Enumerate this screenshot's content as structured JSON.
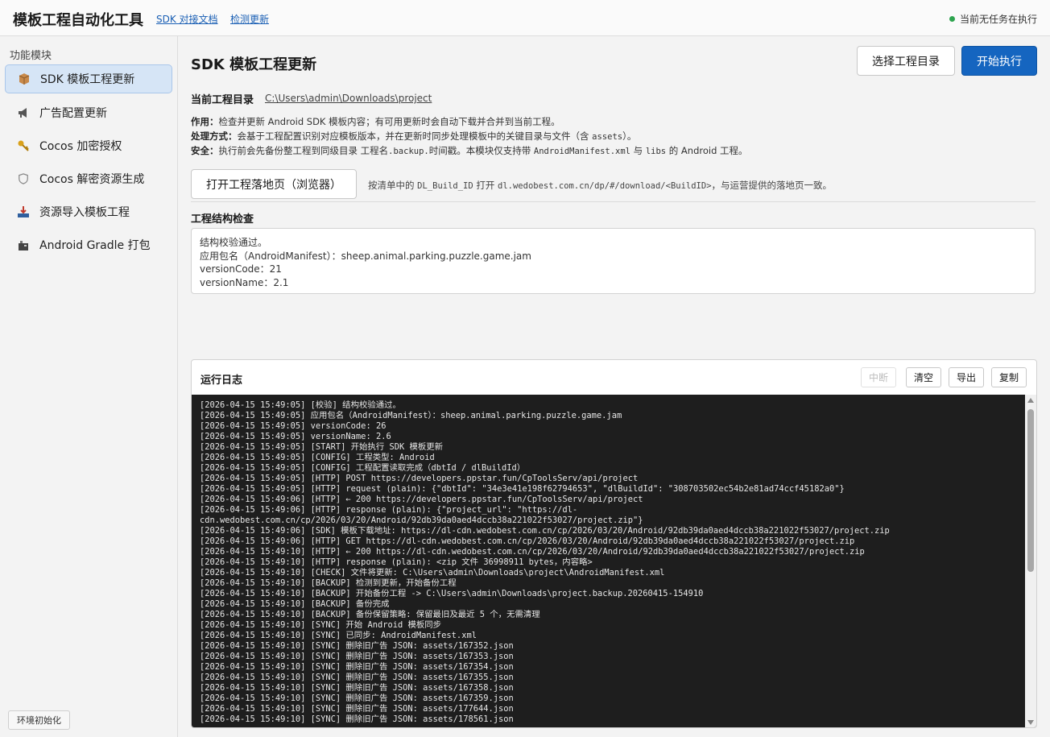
{
  "header": {
    "app_title": "模板工程自动化工具",
    "links": [
      "SDK 对接文档",
      "检测更新"
    ],
    "status": "当前无任务在执行"
  },
  "sidebar": {
    "title": "功能模块",
    "items": [
      {
        "label": "SDK 模板工程更新",
        "icon": "package-icon",
        "active": true
      },
      {
        "label": "广告配置更新",
        "icon": "megaphone-icon",
        "active": false
      },
      {
        "label": "Cocos 加密授权",
        "icon": "key-icon",
        "active": false
      },
      {
        "label": "Cocos 解密资源生成",
        "icon": "shield-icon",
        "active": false
      },
      {
        "label": "资源导入模板工程",
        "icon": "import-icon",
        "active": false
      },
      {
        "label": "Android Gradle 打包",
        "icon": "build-icon",
        "active": false
      }
    ],
    "env_button": "环境初始化"
  },
  "main": {
    "title": "SDK 模板工程更新",
    "select_dir_button": "选择工程目录",
    "start_button": "开始执行",
    "dir_label": "当前工程目录",
    "dir_value": "C:\\Users\\admin\\Downloads\\project",
    "desc": {
      "purpose_label": "作用：",
      "purpose_text": "检查并更新 Android SDK 模板内容；有可用更新时会自动下载并合并到当前工程。",
      "method_label": "处理方式：",
      "method_text_1": "会基于工程配置识别对应模板版本，并在更新时同步处理模板中的关键目录与文件（含 ",
      "method_code": "assets",
      "method_text_2": "）。",
      "safety_label": "安全：",
      "safety_text_1": "执行前会先备份整工程到同级目录 工程名",
      "safety_code_1": ".backup.",
      "safety_text_2": "时间戳。本模块仅支持带 ",
      "safety_code_2": "AndroidManifest.xml",
      "safety_text_3": " 与 ",
      "safety_code_3": "libs",
      "safety_text_4": " 的 Android 工程。"
    },
    "landing_button": "打开工程落地页（浏览器）",
    "hint": {
      "text_1": "按清单中的 ",
      "code_1": "DL_Build_ID",
      "text_2": " 打开 ",
      "code_2": "dl.wedobest.com.cn/dp/#/download/<BuildID>",
      "text_3": "，与运营提供的落地页一致。"
    },
    "check_title": "工程结构检查",
    "check_lines": [
      "结构校验通过。",
      "应用包名（AndroidManifest）：sheep.animal.parking.puzzle.game.jam",
      "versionCode：21",
      "versionName：2.1"
    ]
  },
  "log": {
    "title": "运行日志",
    "buttons": {
      "interrupt": "中断",
      "clear": "清空",
      "export": "导出",
      "copy": "复制"
    },
    "lines": [
      "[2026-04-15 15:49:05] [校验] 结构校验通过。",
      "[2026-04-15 15:49:05] 应用包名（AndroidManifest）：sheep.animal.parking.puzzle.game.jam",
      "[2026-04-15 15:49:05] versionCode: 26",
      "[2026-04-15 15:49:05] versionName: 2.6",
      "[2026-04-15 15:49:05] [START] 开始执行 SDK 模板更新",
      "[2026-04-15 15:49:05] [CONFIG] 工程类型: Android",
      "[2026-04-15 15:49:05] [CONFIG] 工程配置读取完成（dbtId / dlBuildId）",
      "[2026-04-15 15:49:05] [HTTP] POST https://developers.ppstar.fun/CpToolsServ/api/project",
      "[2026-04-15 15:49:05] [HTTP] request (plain): {\"dbtId\": \"34e3e41e198f62794653\", \"dlBuildId\": \"308703502ec54b2e81ad74ccf45182a0\"}",
      "[2026-04-15 15:49:06] [HTTP] ← 200 https://developers.ppstar.fun/CpToolsServ/api/project",
      "[2026-04-15 15:49:06] [HTTP] response (plain): {\"project_url\": \"https://dl-",
      "cdn.wedobest.com.cn/cp/2026/03/20/Android/92db39da0aed4dccb38a221022f53027/project.zip\"}",
      "[2026-04-15 15:49:06] [SDK] 模板下载地址: https://dl-cdn.wedobest.com.cn/cp/2026/03/20/Android/92db39da0aed4dccb38a221022f53027/project.zip",
      "[2026-04-15 15:49:06] [HTTP] GET https://dl-cdn.wedobest.com.cn/cp/2026/03/20/Android/92db39da0aed4dccb38a221022f53027/project.zip",
      "[2026-04-15 15:49:10] [HTTP] ← 200 https://dl-cdn.wedobest.com.cn/cp/2026/03/20/Android/92db39da0aed4dccb38a221022f53027/project.zip",
      "[2026-04-15 15:49:10] [HTTP] response (plain): <zip 文件 36998911 bytes，内容略>",
      "[2026-04-15 15:49:10] [CHECK] 文件将更新: C:\\Users\\admin\\Downloads\\project\\AndroidManifest.xml",
      "[2026-04-15 15:49:10] [BACKUP] 检测到更新，开始备份工程",
      "[2026-04-15 15:49:10] [BACKUP] 开始备份工程 -> C:\\Users\\admin\\Downloads\\project.backup.20260415-154910",
      "[2026-04-15 15:49:10] [BACKUP] 备份完成",
      "[2026-04-15 15:49:10] [BACKUP] 备份保留策略: 保留最旧及最近 5 个，无需清理",
      "[2026-04-15 15:49:10] [SYNC] 开始 Android 模板同步",
      "[2026-04-15 15:49:10] [SYNC] 已同步: AndroidManifest.xml",
      "[2026-04-15 15:49:10] [SYNC] 删除旧广告 JSON: assets/167352.json",
      "[2026-04-15 15:49:10] [SYNC] 删除旧广告 JSON: assets/167353.json",
      "[2026-04-15 15:49:10] [SYNC] 删除旧广告 JSON: assets/167354.json",
      "[2026-04-15 15:49:10] [SYNC] 删除旧广告 JSON: assets/167355.json",
      "[2026-04-15 15:49:10] [SYNC] 删除旧广告 JSON: assets/167358.json",
      "[2026-04-15 15:49:10] [SYNC] 删除旧广告 JSON: assets/167359.json",
      "[2026-04-15 15:49:10] [SYNC] 删除旧广告 JSON: assets/177644.json",
      "[2026-04-15 15:49:10] [SYNC] 删除旧广告 JSON: assets/178561.json"
    ]
  },
  "colors": {
    "accent": "#1565c0",
    "status_ok": "#2ea44f",
    "log_bg": "#1e1e1e",
    "nav_active_bg": "#d6e5f6"
  }
}
